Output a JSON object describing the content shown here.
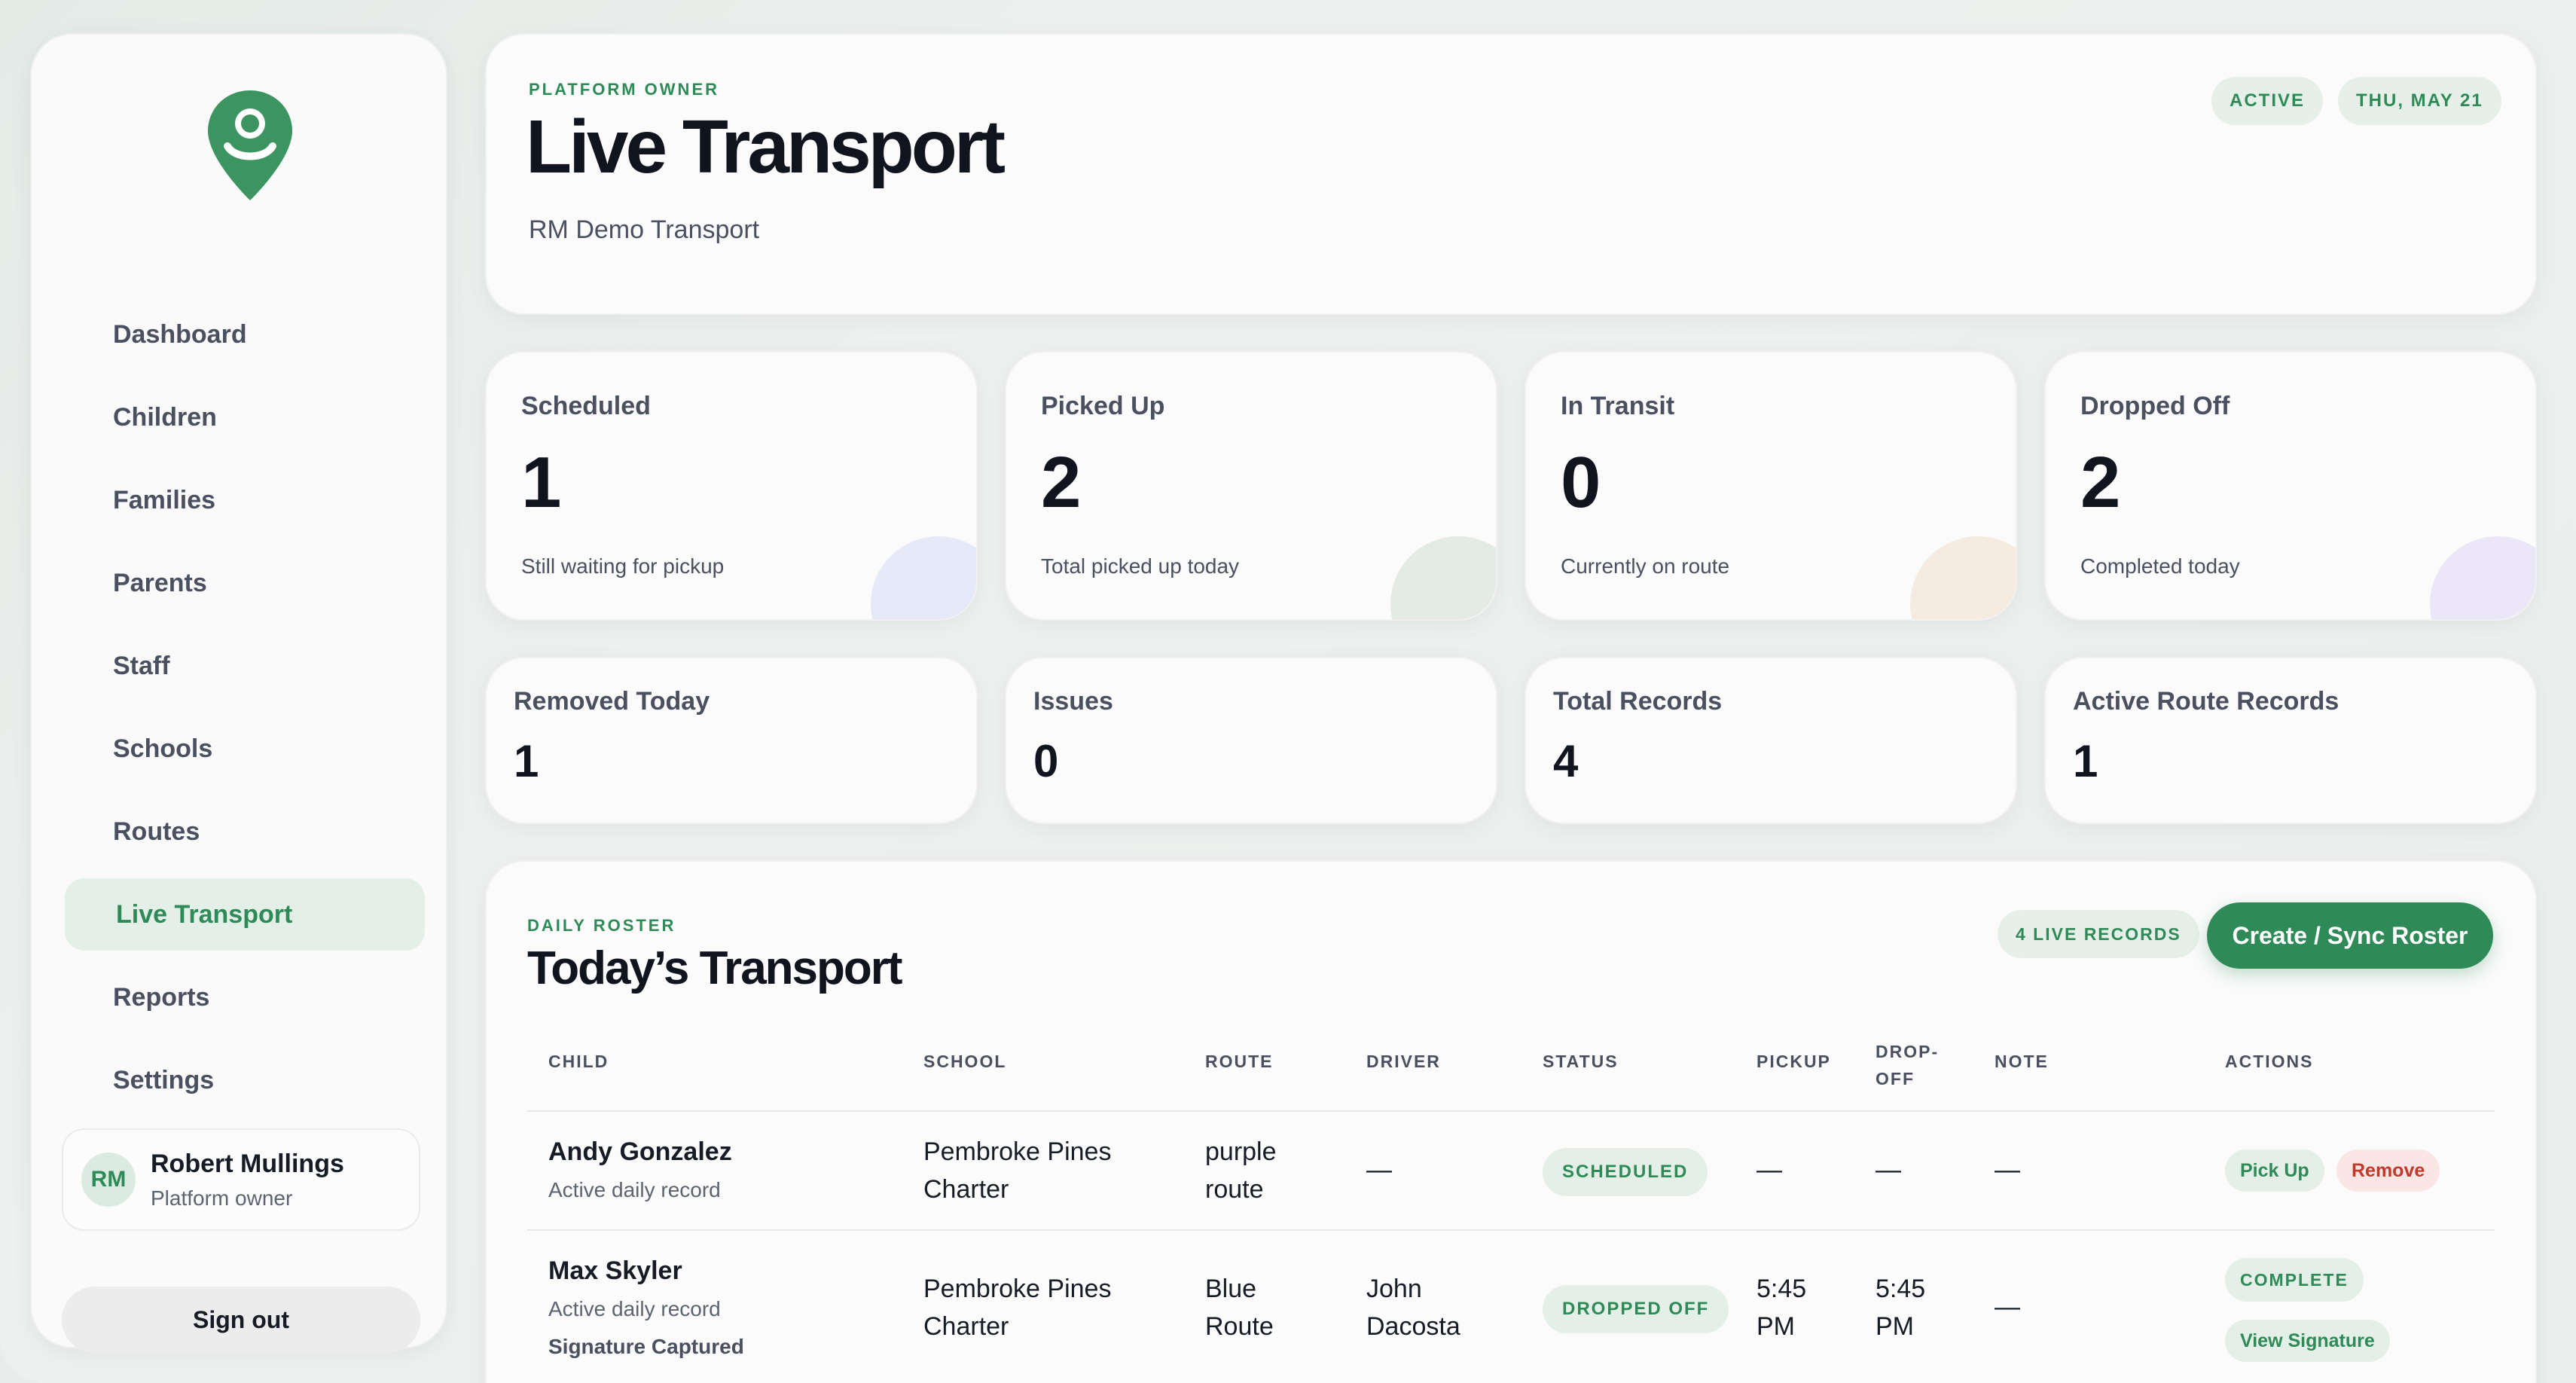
{
  "sidebar": {
    "items": [
      {
        "label": "Dashboard"
      },
      {
        "label": "Children"
      },
      {
        "label": "Families"
      },
      {
        "label": "Parents"
      },
      {
        "label": "Staff"
      },
      {
        "label": "Schools"
      },
      {
        "label": "Routes"
      },
      {
        "label": "Live Transport",
        "active": true
      },
      {
        "label": "Reports"
      },
      {
        "label": "Settings"
      }
    ],
    "user": {
      "initials": "RM",
      "name": "Robert Mullings",
      "role": "Platform owner"
    },
    "signout_label": "Sign out"
  },
  "header": {
    "eyebrow": "PLATFORM OWNER",
    "title": "Live Transport",
    "subtitle": "RM Demo Transport",
    "status_pill": "ACTIVE",
    "date_pill": "THU, MAY 21"
  },
  "stats": [
    {
      "label": "Scheduled",
      "value": "1",
      "sub": "Still waiting for pickup",
      "blob_color": "#e6e9f7"
    },
    {
      "label": "Picked Up",
      "value": "2",
      "sub": "Total picked up today",
      "blob_color": "#e4ebe4"
    },
    {
      "label": "In Transit",
      "value": "0",
      "sub": "Currently on route",
      "blob_color": "#f6ebe0"
    },
    {
      "label": "Dropped Off",
      "value": "2",
      "sub": "Completed today",
      "blob_color": "#ece7f8"
    }
  ],
  "stats2": [
    {
      "label": "Removed Today",
      "value": "1"
    },
    {
      "label": "Issues",
      "value": "0"
    },
    {
      "label": "Total Records",
      "value": "4"
    },
    {
      "label": "Active Route Records",
      "value": "1"
    }
  ],
  "roster": {
    "eyebrow": "DAILY ROSTER",
    "title": "Today’s Transport",
    "records_pill": "4 LIVE RECORDS",
    "create_label": "Create / Sync Roster",
    "columns": {
      "child": "CHILD",
      "school": "SCHOOL",
      "route": "ROUTE",
      "driver": "DRIVER",
      "status": "STATUS",
      "pickup": "PICKUP",
      "dropoff_1": "DROP-",
      "dropoff_2": "OFF",
      "note": "NOTE",
      "actions": "ACTIONS"
    },
    "rows": [
      {
        "child": "Andy Gonzalez",
        "child_sub": "Active daily record",
        "school_1": "Pembroke Pines",
        "school_2": "Charter",
        "route_1": "purple",
        "route_2": "route",
        "driver": "—",
        "status": "SCHEDULED",
        "pickup": "—",
        "dropoff": "—",
        "note": "—",
        "action_1": "Pick Up",
        "action_2": "Remove"
      },
      {
        "child": "Max Skyler",
        "child_sub": "Active daily record",
        "child_extra": "Signature Captured",
        "school_1": "Pembroke Pines",
        "school_2": "Charter",
        "route_1": "Blue",
        "route_2": "Route",
        "driver_1": "John",
        "driver_2": "Dacosta",
        "status": "DROPPED OFF",
        "pickup_1": "5:45",
        "pickup_2": "PM",
        "dropoff_1": "5:45",
        "dropoff_2": "PM",
        "note": "—",
        "action_1": "COMPLETE",
        "action_2": "View Signature"
      }
    ]
  },
  "colors": {
    "accent": "#2e8b57",
    "danger": "#c0392b"
  }
}
